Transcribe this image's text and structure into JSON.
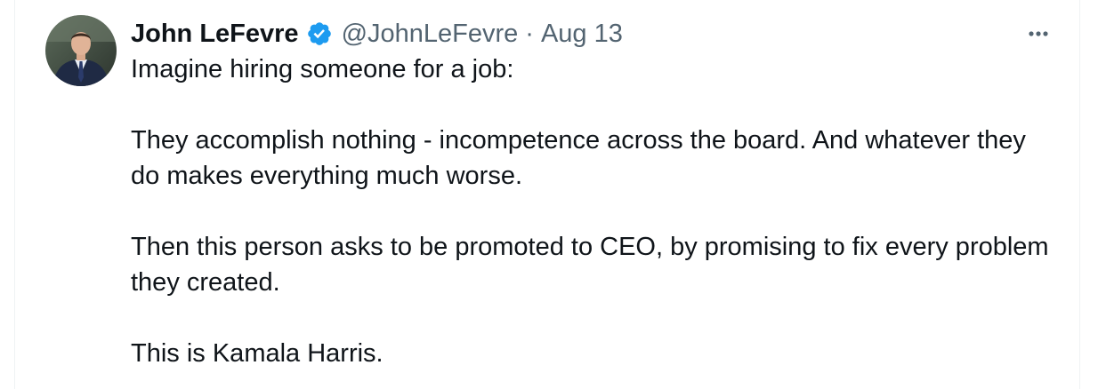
{
  "tweet": {
    "author": {
      "display_name": "John LeFevre",
      "handle": "@JohnLeFevre",
      "verified": true
    },
    "separator": "·",
    "date": "Aug 13",
    "paragraphs": [
      "Imagine hiring someone for a job:",
      "They accomplish nothing - incompetence across the board. And whatever they do makes everything much worse.",
      "Then this person asks to be promoted to CEO, by promising to fix every problem they created.",
      "This is Kamala Harris."
    ]
  },
  "icons": {
    "verified": "verified-badge-icon",
    "more": "more-options-icon"
  },
  "colors": {
    "text_primary": "#0f1419",
    "text_secondary": "#536471",
    "verified_blue": "#1d9bf0",
    "border": "#eff3f4"
  }
}
